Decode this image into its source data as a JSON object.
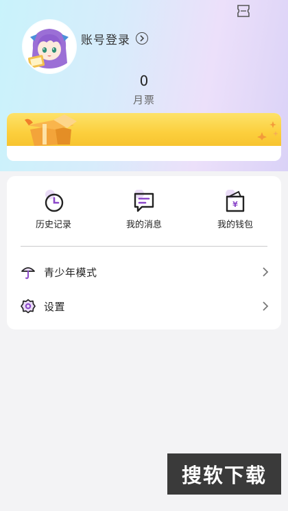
{
  "header": {
    "login_label": "账号登录",
    "monthly_ticket_count": "0",
    "monthly_ticket_label": "月票"
  },
  "quick_actions": [
    {
      "label": "历史记录",
      "icon": "clock-icon"
    },
    {
      "label": "我的消息",
      "icon": "message-icon"
    },
    {
      "label": "我的钱包",
      "icon": "wallet-icon"
    }
  ],
  "menu": [
    {
      "label": "青少年模式",
      "icon": "umbrella-icon"
    },
    {
      "label": "设置",
      "icon": "gear-icon"
    }
  ],
  "watermark": {
    "text": "搜软下载"
  },
  "colors": {
    "accent_purple": "#8b47c9",
    "banner_yellow": "#fcd444",
    "page_background": "#f3f3f5"
  }
}
